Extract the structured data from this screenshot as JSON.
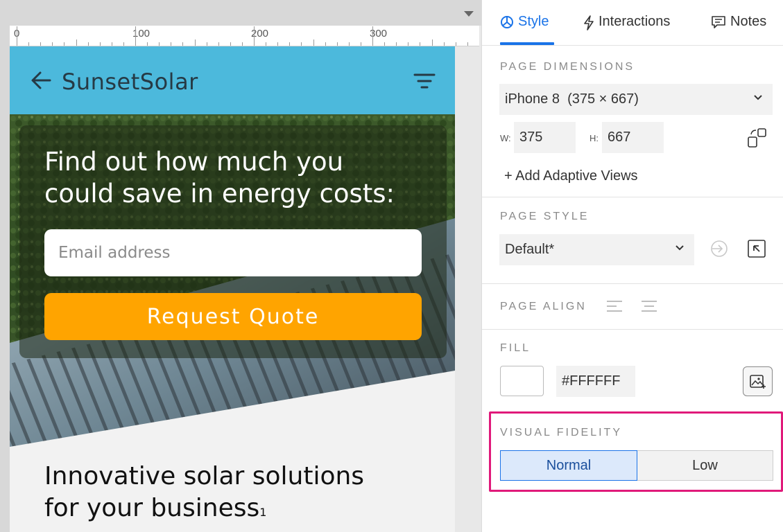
{
  "ruler": {
    "labels": [
      "0",
      "100",
      "200",
      "300"
    ]
  },
  "app": {
    "title": "SunsetSolar",
    "hero_heading_line1": "Find out how much you",
    "hero_heading_line2": "could save in energy costs:",
    "email_placeholder": "Email address",
    "quote_button": "Request Quote",
    "section_heading_line1": "Innovative solar solutions",
    "section_heading_line2": "for your business",
    "footnote": "1",
    "colors": {
      "appbar": "#4cb9dc",
      "button": "#ffa400"
    }
  },
  "inspector": {
    "tabs": [
      {
        "label": "Style",
        "icon": "style-icon",
        "active": true
      },
      {
        "label": "Interactions",
        "icon": "lightning-icon",
        "active": false
      },
      {
        "label": "Notes",
        "icon": "notes-icon",
        "active": false
      }
    ],
    "page_dimensions": {
      "title": "PAGE DIMENSIONS",
      "device": "iPhone 8  (375 × 667)",
      "w_label": "W:",
      "w_value": "375",
      "h_label": "H:",
      "h_value": "667",
      "add_adaptive": "+ Add Adaptive Views"
    },
    "page_style": {
      "title": "PAGE STYLE",
      "value": "Default*"
    },
    "page_align": {
      "title": "PAGE ALIGN"
    },
    "fill": {
      "title": "FILL",
      "hex": "#FFFFFF",
      "color": "#FFFFFF"
    },
    "visual_fidelity": {
      "title": "VISUAL FIDELITY",
      "options": [
        "Normal",
        "Low"
      ],
      "selected": "Normal"
    },
    "accent_color": "#1a73e8",
    "highlight_color": "#e0197a"
  }
}
